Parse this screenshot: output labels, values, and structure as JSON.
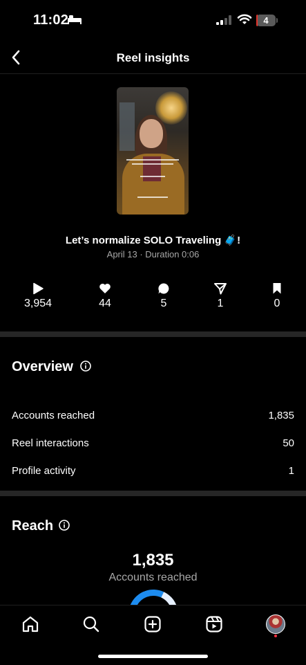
{
  "status_bar": {
    "time": "11:02",
    "battery_level": "4",
    "battery_color": "#e6332a"
  },
  "header": {
    "title": "Reel insights"
  },
  "reel": {
    "caption": "Let’s normalize SOLO Traveling 🧳!",
    "meta": "April 13 · Duration 0:06"
  },
  "metrics": [
    {
      "icon": "play-icon",
      "value": "3,954"
    },
    {
      "icon": "heart-icon",
      "value": "44"
    },
    {
      "icon": "comment-icon",
      "value": "5"
    },
    {
      "icon": "share-icon",
      "value": "1"
    },
    {
      "icon": "save-icon",
      "value": "0"
    }
  ],
  "overview": {
    "title": "Overview",
    "rows": [
      {
        "label": "Accounts reached",
        "value": "1,835"
      },
      {
        "label": "Reel interactions",
        "value": "50"
      },
      {
        "label": "Profile activity",
        "value": "1"
      }
    ]
  },
  "reach": {
    "title": "Reach",
    "value": "1,835",
    "label": "Accounts reached",
    "donut_colors": [
      "#1d8cf0",
      "#e6f0ff"
    ]
  },
  "tab_bar": {
    "tabs": [
      "home-icon",
      "search-icon",
      "create-icon",
      "reels-icon",
      "profile-avatar"
    ],
    "notification_color": "#ff3040"
  }
}
